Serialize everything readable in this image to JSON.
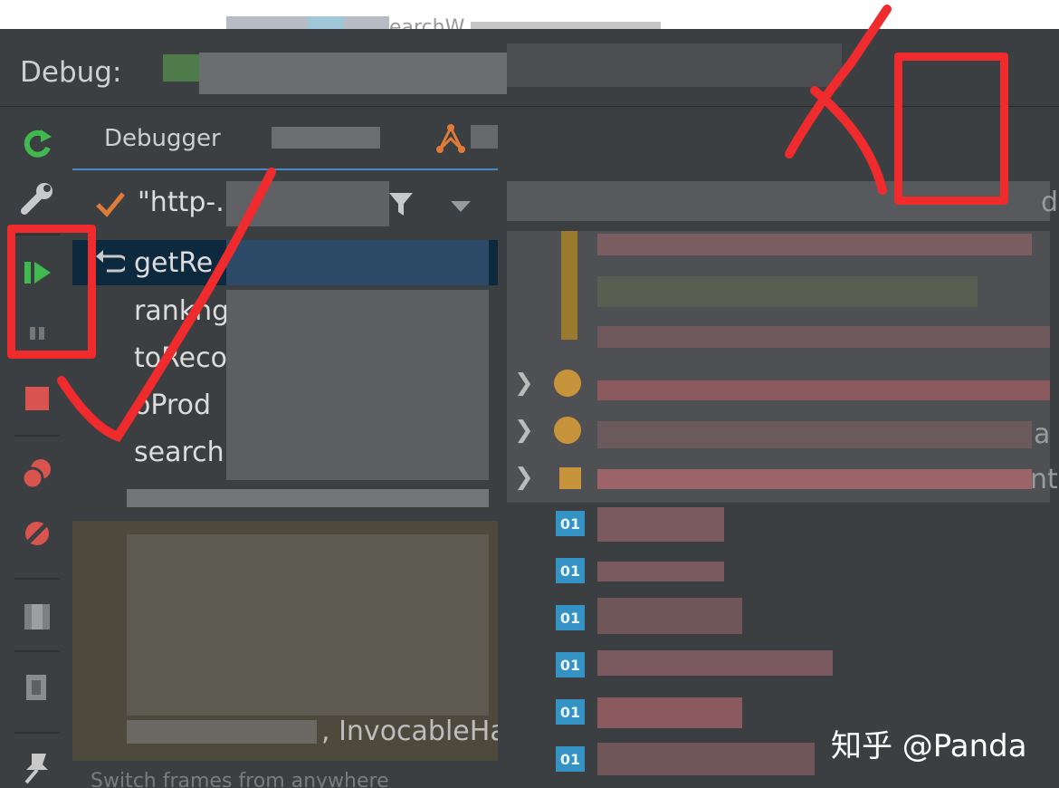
{
  "top": {
    "title_fragment": "earchW"
  },
  "debug": {
    "label": "Debug:"
  },
  "tabs": {
    "debugger": "Debugger"
  },
  "threads": {
    "selected_text": "\"http-."
  },
  "frames": [
    {
      "label": "getRe"
    },
    {
      "label": "rankng"
    },
    {
      "label": "toReco"
    },
    {
      "label": "oProd"
    },
    {
      "label": "search"
    }
  ],
  "console_fragment": ", InvocableHa",
  "status_fragment": "Switch frames from anywhere",
  "watermark": "知乎 @Panda",
  "badges": {
    "o1": "01",
    "partial_right_1": "d",
    "partial_right_2": "a",
    "partial_right_3": "nt"
  },
  "colors": {
    "accent": "#4a88c7",
    "annotation": "#ef2b2d",
    "selected_frame": "#0d293e",
    "resume_green": "#3fb950",
    "stop_red": "#d9534f"
  },
  "icons": [
    "rerun-icon",
    "settings-icon",
    "resume-icon",
    "pause-icon",
    "stop-icon",
    "view-breakpoints-icon",
    "mute-breakpoints-icon",
    "restore-layout-icon",
    "settings-gear-icon",
    "pin-icon",
    "filter-icon",
    "dropdown-icon",
    "step-into-my-code-icon",
    "evaluate-expression-icon",
    "thread-check-icon",
    "return-arrow-icon",
    "chevron-right-icon"
  ]
}
